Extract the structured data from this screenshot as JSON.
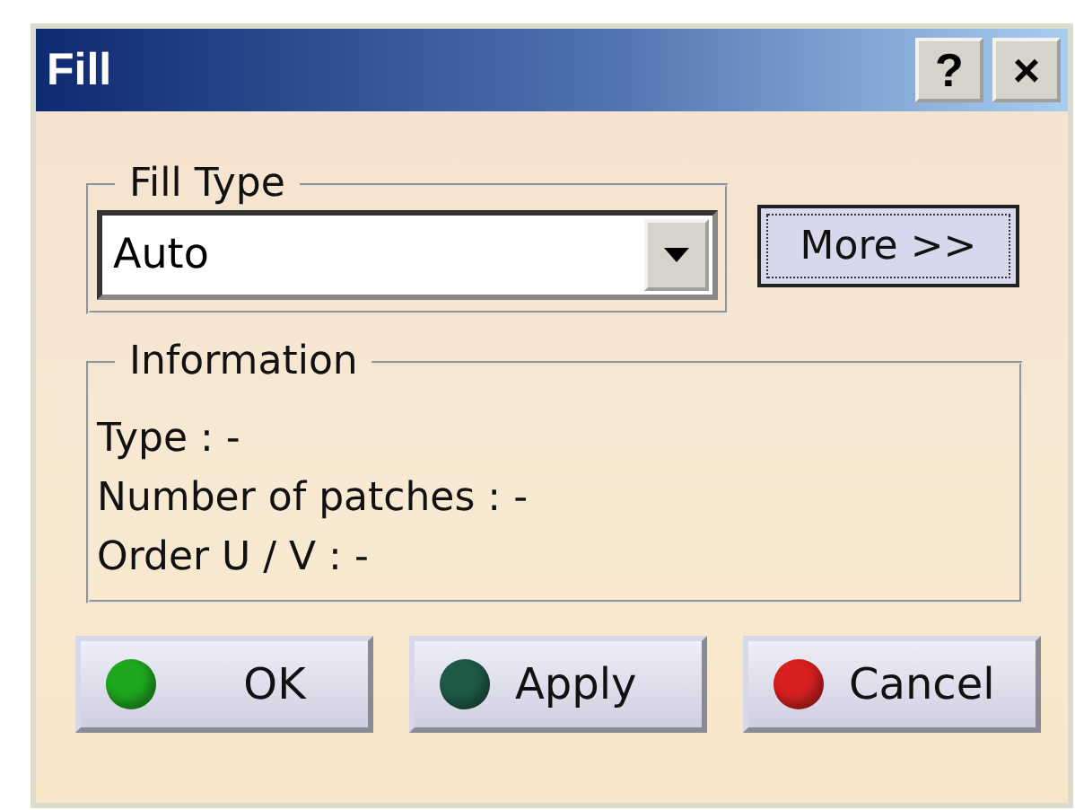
{
  "window": {
    "title": "Fill",
    "title_buttons": [
      "?",
      "×"
    ]
  },
  "fill_type": {
    "legend": "Fill Type",
    "value": "Auto"
  },
  "more_button": "More >>",
  "information": {
    "legend": "Information",
    "lines": [
      "Type : -",
      "Number of patches : -",
      "Order U / V : -"
    ]
  },
  "buttons": [
    {
      "label": "OK",
      "color": "#1fa81f"
    },
    {
      "label": "Apply",
      "color": "#1f5a48"
    },
    {
      "label": "Cancel",
      "color": "#d82020"
    }
  ]
}
